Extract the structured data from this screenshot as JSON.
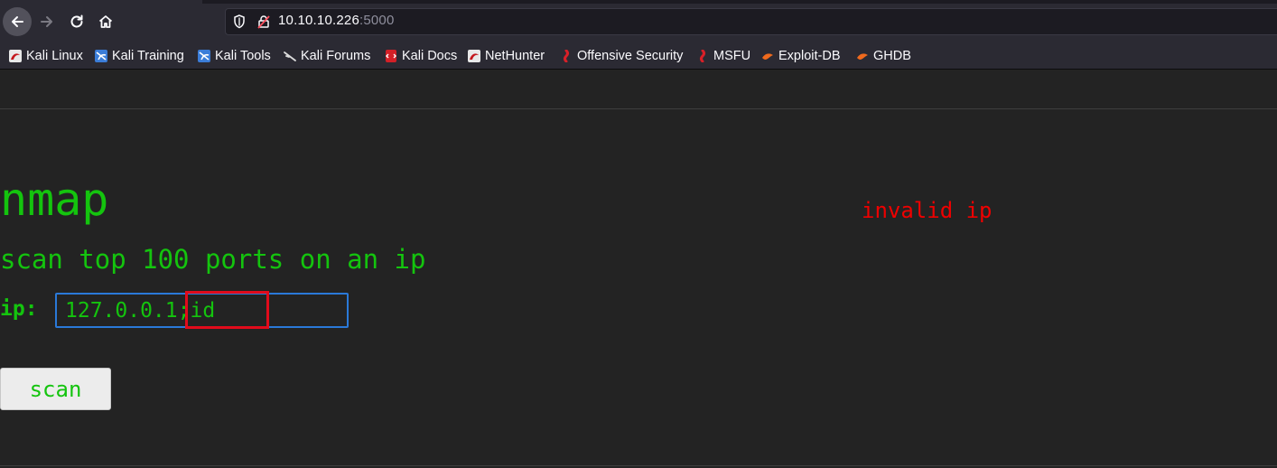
{
  "browser": {
    "url_host": "10.10.10.226",
    "url_port": ":5000",
    "bookmarks": [
      {
        "label": "Kali Linux",
        "icon": "kali-dragon-icon"
      },
      {
        "label": "Kali Training",
        "icon": "kali-training-icon"
      },
      {
        "label": "Kali Tools",
        "icon": "kali-tools-icon"
      },
      {
        "label": "Kali Forums",
        "icon": "kali-forums-icon"
      },
      {
        "label": "Kali Docs",
        "icon": "kali-docs-icon"
      },
      {
        "label": "NetHunter",
        "icon": "nethunter-icon"
      },
      {
        "label": "Offensive Security",
        "icon": "offsec-icon"
      },
      {
        "label": "MSFU",
        "icon": "msfu-icon"
      },
      {
        "label": "Exploit-DB",
        "icon": "exploitdb-icon"
      },
      {
        "label": "GHDB",
        "icon": "ghdb-icon"
      }
    ]
  },
  "page": {
    "title": "nmap",
    "subtitle": "scan top 100 ports on an ip",
    "error": "invalid ip",
    "ip_label": "ip:",
    "ip_value": "127.0.0.1;id",
    "scan_label": "scan"
  },
  "colors": {
    "accent_green": "#14c40e",
    "error_red": "#ef0000",
    "highlight_red": "#e10b1b",
    "background": "#232323"
  }
}
